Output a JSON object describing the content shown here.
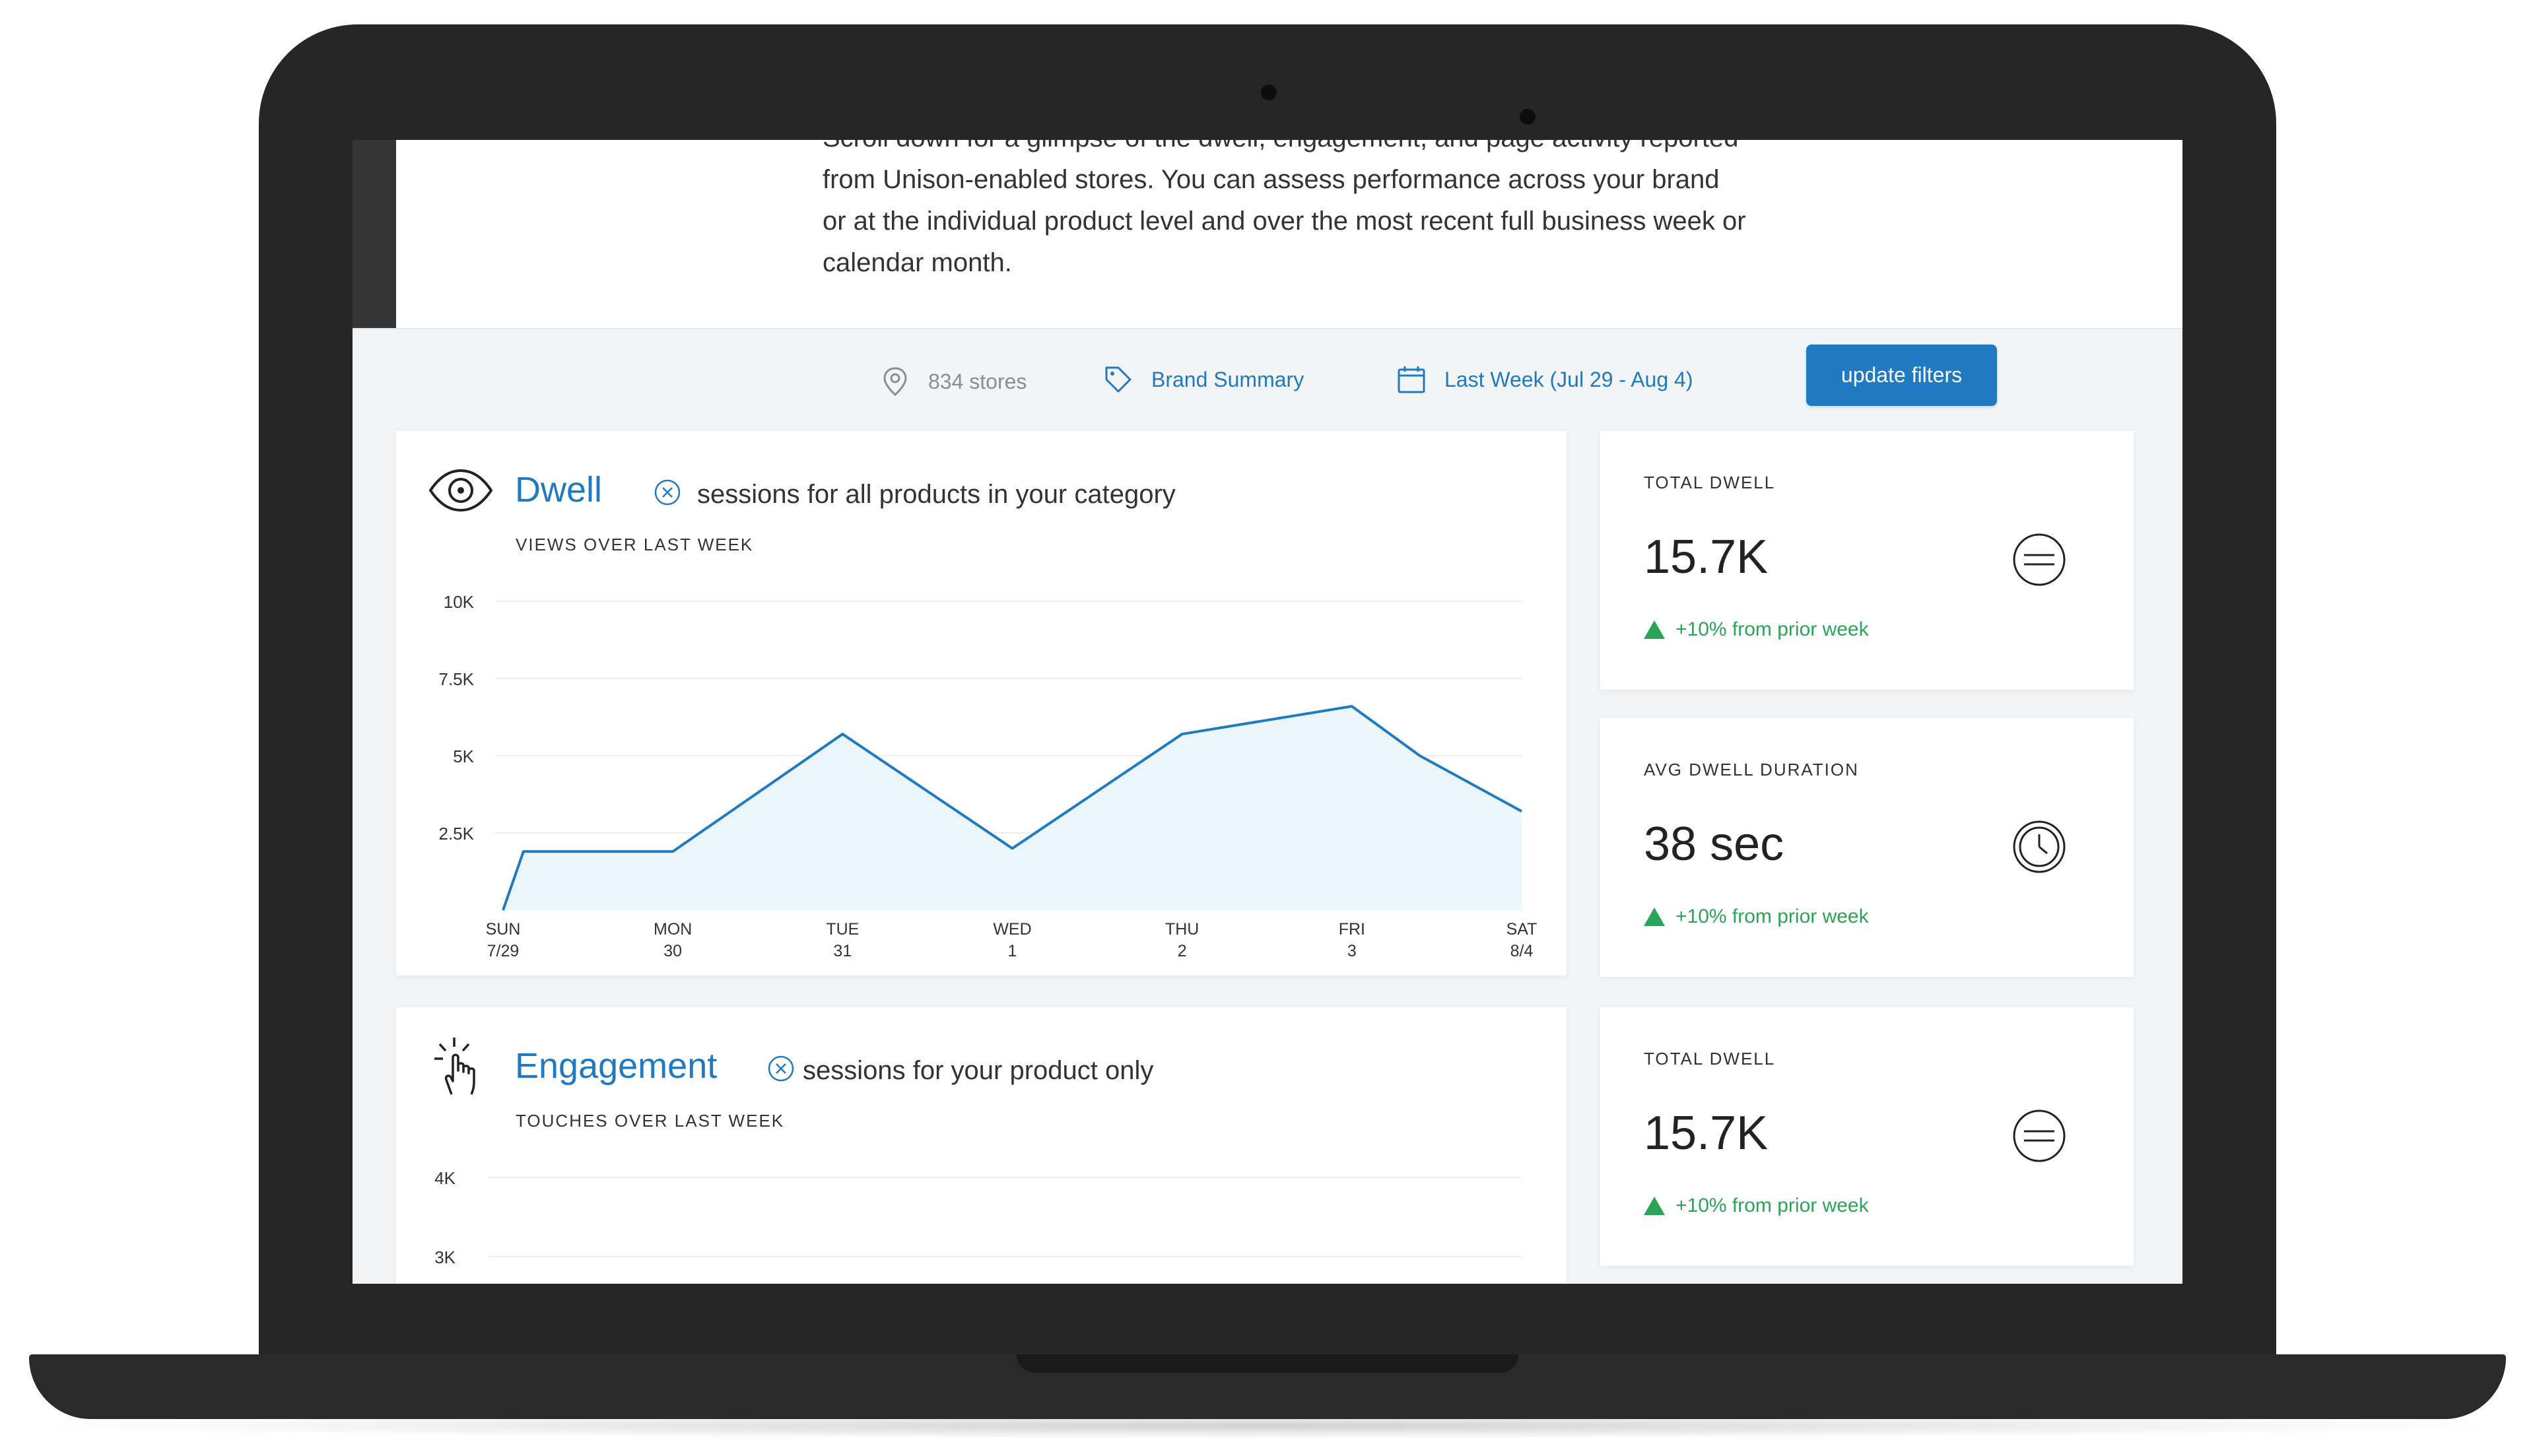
{
  "intro": {
    "text": "Scroll down for a glimpse of the dwell, engagement, and page activity reported from Unison-enabled stores. You can assess performance across your brand or at the individual product level and over the most recent full business week or calendar month."
  },
  "filters": {
    "stores": "834 stores",
    "brand": "Brand Summary",
    "date": "Last Week (Jul 29 - Aug 4)",
    "update": "update filters"
  },
  "dwell": {
    "title": "Dwell",
    "subtitle": "sessions for all products in your category",
    "chart_label": "VIEWS OVER LAST WEEK"
  },
  "engagement": {
    "title": "Engagement",
    "subtitle": "sessions for your product only",
    "chart_label": "TOUCHES OVER LAST WEEK"
  },
  "stats": [
    {
      "label": "TOTAL DWELL",
      "value": "15.7K",
      "change": "+10% from prior week",
      "icon": "equals-circle-icon"
    },
    {
      "label": "AVG DWELL DURATION",
      "value": "38 sec",
      "change": "+10% from prior week",
      "icon": "clock-icon"
    },
    {
      "label": "TOTAL DWELL",
      "value": "15.7K",
      "change": "+10% from prior week",
      "icon": "equals-circle-icon"
    }
  ],
  "colors": {
    "accent": "#1f7ac2",
    "positive": "#2ca457",
    "fill": "#eaf6fc"
  },
  "chart_data": [
    {
      "type": "area",
      "ylim": [
        0,
        10000
      ],
      "ytick_labels": [
        "10K",
        "7.5K",
        "5K",
        "2.5K"
      ],
      "ytick_values": [
        10000,
        7500,
        5000,
        2500
      ],
      "categories": [
        "SUN",
        "MON",
        "TUE",
        "WED",
        "THU",
        "FRI",
        "SAT"
      ],
      "dates": [
        "7/29",
        "30",
        "31",
        "1",
        "2",
        "3",
        "8/4"
      ],
      "x": [
        0,
        0.12,
        1,
        2,
        3,
        4,
        5,
        5.4,
        6
      ],
      "values": [
        0,
        1900,
        1900,
        5700,
        2000,
        5700,
        6600,
        5000,
        3200
      ]
    },
    {
      "type": "area",
      "ytick_labels": [
        "4K",
        "3K"
      ],
      "ytick_values": [
        4000,
        3000
      ],
      "ylim": [
        0,
        4000
      ],
      "x": [],
      "values": []
    }
  ]
}
